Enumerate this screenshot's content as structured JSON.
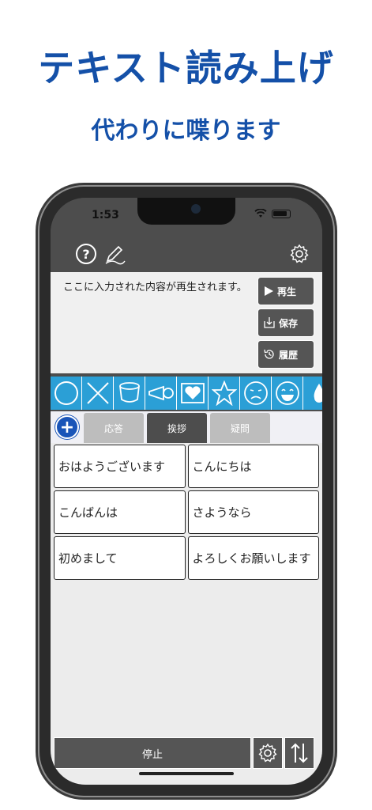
{
  "promo": {
    "title": "テキスト読み上げ",
    "subtitle": "代わりに喋ります"
  },
  "status": {
    "time": "1:53"
  },
  "toolbar": {
    "help_icon": "help-icon",
    "edit_icon": "pen-icon",
    "settings_icon": "gear-icon"
  },
  "text_area": {
    "content": "ここに入力された内容が再生されます。"
  },
  "actions": {
    "play": "再生",
    "save": "保存",
    "history": "履歴"
  },
  "stamps": [
    "circle",
    "cross",
    "cup",
    "horn",
    "heart",
    "star",
    "sad-face",
    "smile-face",
    "drop"
  ],
  "tabs": {
    "add": "+",
    "items": [
      {
        "label": "応答",
        "active": false
      },
      {
        "label": "挨拶",
        "active": true
      },
      {
        "label": "疑問",
        "active": false
      }
    ]
  },
  "phrases": [
    "おはようございます",
    "こんにちは",
    "こんばんは",
    "さようなら",
    "初めまして",
    "よろしくお願いします"
  ],
  "bottom": {
    "stop": "停止",
    "settings_icon": "gear-icon",
    "sort_icon": "sort-arrows-icon"
  },
  "colors": {
    "accent_blue": "#1450a8",
    "stamp_strip": "#2b9fd6",
    "dark_gray": "#4d4d4d"
  }
}
